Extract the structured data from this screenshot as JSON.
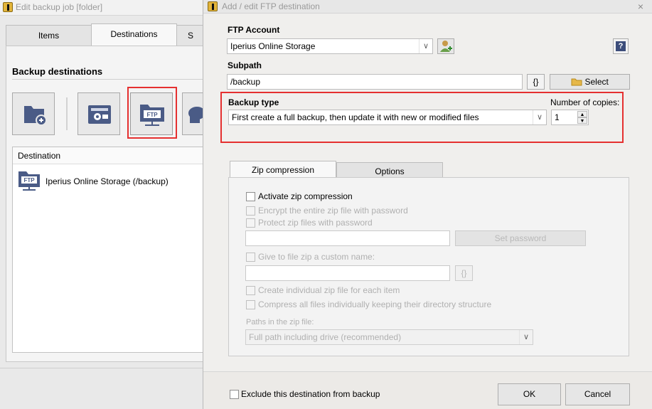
{
  "background_window": {
    "title": "Edit backup job   [folder]",
    "tabs": [
      {
        "label": "Items"
      },
      {
        "label": "Destinations"
      },
      {
        "label": "S"
      }
    ],
    "section_title": "Backup destinations",
    "list_header": "Destination",
    "list_items": [
      {
        "label": "Iperius Online Storage (/backup)",
        "icon": "ftp-folder-icon"
      }
    ],
    "tiles": [
      "add-folder-icon",
      "tape-drive-icon",
      "ftp-folder-icon",
      "cloud-lock-icon"
    ]
  },
  "dialog": {
    "title": "Add / edit FTP destination",
    "ftp_account": {
      "label": "FTP Account",
      "value": "Iperius Online Storage"
    },
    "subpath": {
      "label": "Subpath",
      "value": "/backup",
      "var_button": "{}",
      "select_button": "Select"
    },
    "backup_type": {
      "label": "Backup type",
      "value": "First create a full backup, then update it with new or modified files",
      "copies_label": "Number of copies:",
      "copies_value": "1"
    },
    "tabs": [
      {
        "label": "Zip compression"
      },
      {
        "label": "Options"
      }
    ],
    "zip": {
      "activate": "Activate zip compression",
      "encrypt": "Encrypt the entire zip file with password",
      "protect": "Protect zip files with password",
      "set_password": "Set password",
      "custom_name": "Give to file zip a custom name:",
      "custom_name_var": "{}",
      "individual": "Create individual zip file for each item",
      "compress_all": "Compress all files individually keeping their directory structure",
      "paths_label": "Paths in the zip file:",
      "paths_value": "Full path including drive (recommended)"
    },
    "exclude": "Exclude this destination from backup",
    "ok": "OK",
    "cancel": "Cancel",
    "close": "×",
    "help": "?"
  },
  "colors": {
    "highlight": "#e53030",
    "folder_blue": "#4a5b86"
  }
}
